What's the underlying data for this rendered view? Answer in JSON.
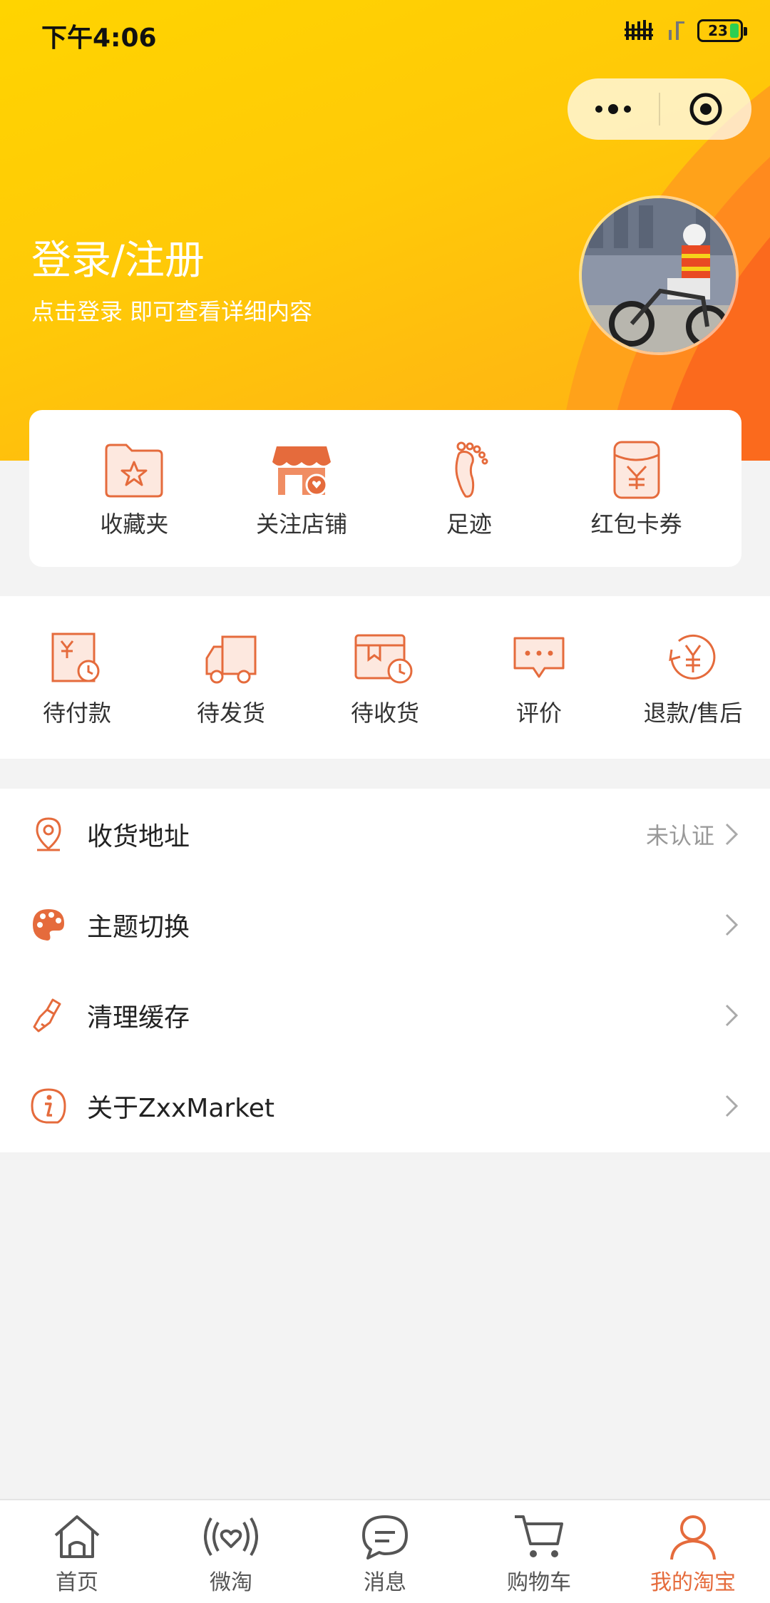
{
  "status_bar": {
    "time": "下午4:06",
    "battery": "23"
  },
  "header": {
    "title": "登录/注册",
    "subtitle": "点击登录 即可查看详细内容"
  },
  "quick_links": [
    {
      "label": "收藏夹",
      "icon": "favorites-folder-icon"
    },
    {
      "label": "关注店铺",
      "icon": "store-icon"
    },
    {
      "label": "足迹",
      "icon": "footprint-icon"
    },
    {
      "label": "红包卡券",
      "icon": "coupon-icon"
    }
  ],
  "orders": [
    {
      "label": "待付款",
      "icon": "pending-payment-icon"
    },
    {
      "label": "待发货",
      "icon": "truck-icon"
    },
    {
      "label": "待收货",
      "icon": "pending-receipt-icon"
    },
    {
      "label": "评价",
      "icon": "comment-icon"
    },
    {
      "label": "退款/售后",
      "icon": "refund-icon"
    }
  ],
  "settings": [
    {
      "label": "收货地址",
      "value": "未认证",
      "icon": "location-pin-icon"
    },
    {
      "label": "主题切换",
      "value": "",
      "icon": "palette-icon"
    },
    {
      "label": "清理缓存",
      "value": "",
      "icon": "broom-icon"
    },
    {
      "label": "关于ZxxMarket",
      "value": "",
      "icon": "info-icon"
    }
  ],
  "tabs": [
    {
      "label": "首页",
      "icon": "home-icon",
      "active": false
    },
    {
      "label": "微淘",
      "icon": "broadcast-heart-icon",
      "active": false
    },
    {
      "label": "消息",
      "icon": "message-icon",
      "active": false
    },
    {
      "label": "购物车",
      "icon": "cart-icon",
      "active": false
    },
    {
      "label": "我的淘宝",
      "icon": "user-icon",
      "active": true
    }
  ],
  "colors": {
    "accent": "#e56b3c",
    "header_yellow": "#ffc908",
    "header_orange": "#fb6a1d"
  }
}
